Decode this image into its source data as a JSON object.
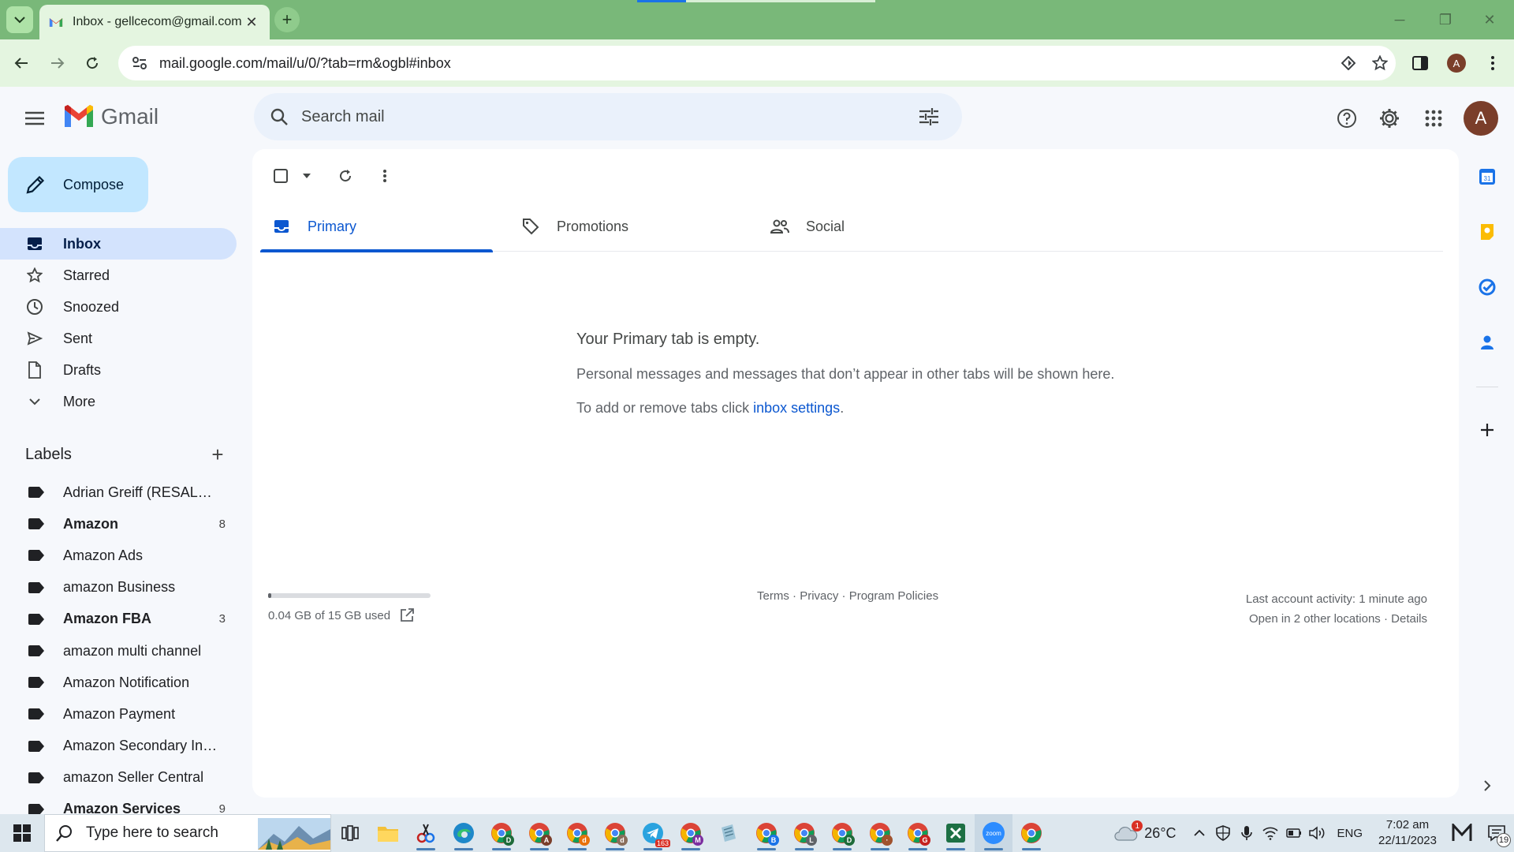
{
  "browser": {
    "tab_title": "Inbox - gellcecom@gmail.com",
    "tab_close": "✕",
    "new_tab": "+",
    "url": "mail.google.com/mail/u/0/?tab=rm&ogbl#inbox",
    "profile_initial": "A",
    "window_controls": [
      "minimize-icon",
      "restore-icon",
      "close-icon"
    ]
  },
  "gmail": {
    "brand": "Gmail",
    "search_placeholder": "Search mail",
    "avatar_initial": "A",
    "header_icons": [
      "help-icon",
      "settings-gear-icon",
      "apps-grid-icon"
    ]
  },
  "sidebar": {
    "compose_label": "Compose",
    "nav": [
      {
        "label": "Inbox",
        "icon": "inbox-icon",
        "active": true
      },
      {
        "label": "Starred",
        "icon": "star-icon"
      },
      {
        "label": "Snoozed",
        "icon": "clock-icon"
      },
      {
        "label": "Sent",
        "icon": "send-icon"
      },
      {
        "label": "Drafts",
        "icon": "draft-icon"
      },
      {
        "label": "More",
        "icon": "chevron-down-icon"
      }
    ],
    "labels_title": "Labels",
    "labels": [
      {
        "name": "Adrian Greiff (RESALE C...",
        "count": "",
        "bold": false
      },
      {
        "name": "Amazon",
        "count": "8",
        "bold": true
      },
      {
        "name": "Amazon Ads",
        "count": "",
        "bold": false
      },
      {
        "name": "amazon Business",
        "count": "",
        "bold": false
      },
      {
        "name": "Amazon FBA",
        "count": "3",
        "bold": true
      },
      {
        "name": "amazon multi channel",
        "count": "",
        "bold": false
      },
      {
        "name": "Amazon Notification",
        "count": "",
        "bold": false
      },
      {
        "name": "Amazon Payment",
        "count": "",
        "bold": false
      },
      {
        "name": "Amazon Secondary Invit...",
        "count": "",
        "bold": false
      },
      {
        "name": "amazon Seller Central",
        "count": "",
        "bold": false
      },
      {
        "name": "Amazon Services",
        "count": "9",
        "bold": true
      }
    ]
  },
  "main": {
    "tabs": [
      {
        "label": "Primary",
        "icon": "inbox-icon",
        "active": true
      },
      {
        "label": "Promotions",
        "icon": "tag-icon"
      },
      {
        "label": "Social",
        "icon": "people-icon"
      }
    ],
    "empty_title": "Your Primary tab is empty.",
    "empty_body": "Personal messages and messages that don’t appear in other tabs will be shown here.",
    "empty_settings_prefix": "To add or remove tabs click ",
    "empty_settings_link": "inbox settings",
    "empty_settings_suffix": ".",
    "storage_text": "0.04 GB of 15 GB used",
    "storage_fraction": 0.003,
    "footer_terms": "Terms",
    "footer_privacy": "Privacy",
    "footer_policies": "Program Policies",
    "footer_sep": " · ",
    "activity_line1": "Last account activity: 1 minute ago",
    "activity_open": "Open in 2 other locations",
    "activity_details": "Details"
  },
  "side_panel": [
    "calendar-icon",
    "keep-icon",
    "tasks-icon",
    "contacts-icon",
    "add-icon"
  ],
  "taskbar": {
    "search_placeholder": "Type here to search",
    "weather": "26°C",
    "weather_badge": "1",
    "language": "ENG",
    "time": "7:02 am",
    "date": "22/11/2023",
    "notification_count": "19",
    "telegram_badge": "163"
  }
}
